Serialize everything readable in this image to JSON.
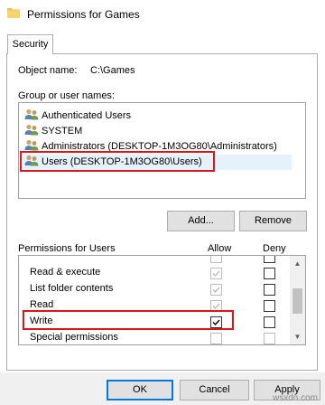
{
  "window": {
    "title": "Permissions for Games"
  },
  "tabs": [
    {
      "label": "Security"
    }
  ],
  "object": {
    "label": "Object name:",
    "value": "C:\\Games"
  },
  "group_section": {
    "label": "Group or user names:",
    "items": [
      {
        "label": "Authenticated Users",
        "icon": "users-group-icon"
      },
      {
        "label": "SYSTEM",
        "icon": "users-group-icon"
      },
      {
        "label": "Administrators (DESKTOP-1M3OG80\\Administrators)",
        "icon": "users-group-icon"
      },
      {
        "label": "Users (DESKTOP-1M3OG80\\Users)",
        "icon": "users-group-icon",
        "selected": true
      }
    ]
  },
  "buttons": {
    "add": "Add...",
    "remove": "Remove",
    "ok": "OK",
    "cancel": "Cancel",
    "apply": "Apply"
  },
  "permissions": {
    "header": "Permissions for Users",
    "allow_header": "Allow",
    "deny_header": "Deny",
    "rows": [
      {
        "name": "Read & execute",
        "allow": true,
        "allow_disabled": true,
        "deny": false
      },
      {
        "name": "List folder contents",
        "allow": true,
        "allow_disabled": true,
        "deny": false
      },
      {
        "name": "Read",
        "allow": true,
        "allow_disabled": true,
        "deny": false
      },
      {
        "name": "Write",
        "allow": true,
        "allow_disabled": false,
        "deny": false
      },
      {
        "name": "Special permissions",
        "allow": false,
        "allow_disabled": true,
        "deny": false,
        "deny_disabled": true
      }
    ]
  },
  "watermark": "wsxdn.com",
  "colors": {
    "highlight": "#d9151d",
    "selection": "#e5f1fb",
    "accent": "#0078d7"
  }
}
